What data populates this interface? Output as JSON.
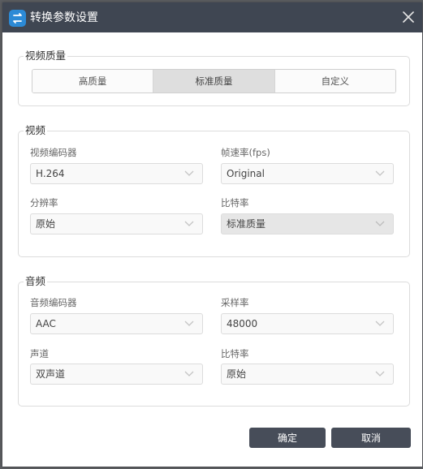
{
  "window": {
    "title": "转换参数设置"
  },
  "quality": {
    "legend": "视频质量",
    "options": [
      "高质量",
      "标准质量",
      "自定义"
    ],
    "selected": "标准质量"
  },
  "video": {
    "legend": "视频",
    "encoder_label": "视频编码器",
    "encoder_value": "H.264",
    "fps_label": "帧速率(fps)",
    "fps_value": "Original",
    "resolution_label": "分辨率",
    "resolution_value": "原始",
    "bitrate_label": "比特率",
    "bitrate_value": "标准质量"
  },
  "audio": {
    "legend": "音频",
    "encoder_label": "音频编码器",
    "encoder_value": "AAC",
    "samplerate_label": "采样率",
    "samplerate_value": "48000",
    "channel_label": "声道",
    "channel_value": "双声道",
    "bitrate_label": "比特率",
    "bitrate_value": "原始"
  },
  "buttons": {
    "ok": "确定",
    "cancel": "取消"
  },
  "colors": {
    "titlebar": "#3f4652",
    "button": "#474d59",
    "accent": "#2c8ad6"
  },
  "icons": {
    "app": "app-logo-icon",
    "close": "close-icon",
    "dropdown": "chevron-down-icon"
  }
}
